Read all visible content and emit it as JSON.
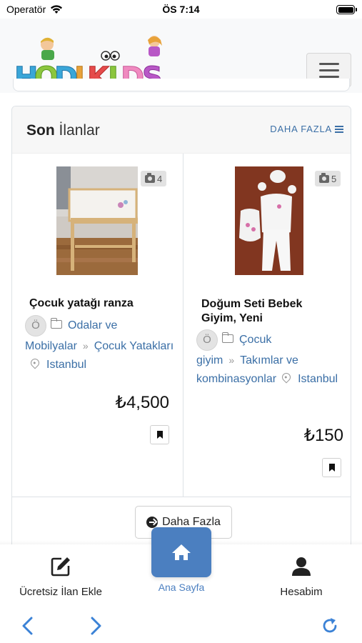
{
  "status_bar": {
    "carrier": "Operatör",
    "time": "ÖS 7:14"
  },
  "header": {
    "logo_text": "HODIKIDS"
  },
  "section": {
    "title_bold": "Son",
    "title_light": "İlanlar",
    "more_link": "DAHA FAZLA"
  },
  "listings": [
    {
      "title": "Çocuk yatağı ranza",
      "photo_count": "4",
      "avatar_letter": "Ö",
      "category_1": "Odalar ve Mobilyalar",
      "category_sep": "»",
      "category_2": "Çocuk Yatakları",
      "location": "Istanbul",
      "price": "₺4,500"
    },
    {
      "title": "Doğum Seti Bebek Giyim, Yeni",
      "photo_count": "5",
      "avatar_letter": "Ö",
      "category_1": "Çocuk giyim",
      "category_sep": "»",
      "category_2": "Takımlar ve kombinasyonlar",
      "location": "Istanbul",
      "price": "₺150"
    }
  ],
  "more_button": "Daha Fazla",
  "bottom_nav": {
    "post_ad": "Ücretsiz İlan Ekle",
    "home": "Ana Sayfa",
    "account": "Hesabim"
  },
  "colors": {
    "accent": "#4b7fc0",
    "link": "#3b6fa6"
  }
}
